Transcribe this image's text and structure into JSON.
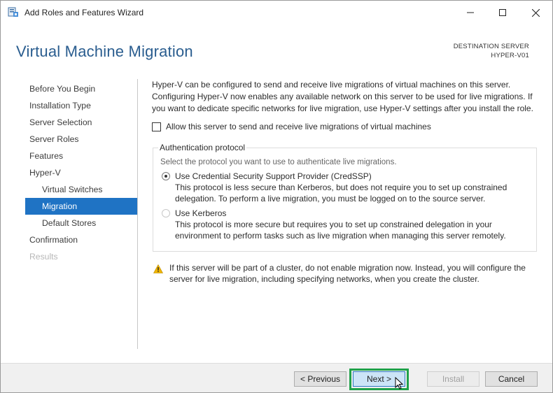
{
  "window": {
    "title": "Add Roles and Features Wizard",
    "controls": {
      "minimize": "minimize-icon",
      "maximize": "maximize-icon",
      "close": "close-icon"
    }
  },
  "header": {
    "page_title": "Virtual Machine Migration",
    "destination_label": "DESTINATION SERVER",
    "destination_server": "HYPER-V01"
  },
  "nav": {
    "items": [
      {
        "label": "Before You Begin",
        "state": "normal"
      },
      {
        "label": "Installation Type",
        "state": "normal"
      },
      {
        "label": "Server Selection",
        "state": "normal"
      },
      {
        "label": "Server Roles",
        "state": "normal"
      },
      {
        "label": "Features",
        "state": "normal"
      },
      {
        "label": "Hyper-V",
        "state": "normal"
      },
      {
        "label": "Virtual Switches",
        "state": "sub"
      },
      {
        "label": "Migration",
        "state": "active"
      },
      {
        "label": "Default Stores",
        "state": "sub"
      },
      {
        "label": "Confirmation",
        "state": "normal"
      },
      {
        "label": "Results",
        "state": "disabled"
      }
    ]
  },
  "content": {
    "intro": "Hyper-V can be configured to send and receive live migrations of virtual machines on this server. Configuring Hyper-V now enables any available network on this server to be used for live migrations. If you want to dedicate specific networks for live migration, use Hyper-V settings after you install the role.",
    "allow_checkbox": {
      "label": "Allow this server to send and receive live migrations of virtual machines",
      "checked": false
    },
    "auth": {
      "legend": "Authentication protocol",
      "description": "Select the protocol you want to use to authenticate live migrations.",
      "options": [
        {
          "title": "Use Credential Security Support Provider (CredSSP)",
          "detail": "This protocol is less secure than Kerberos, but does not require you to set up constrained delegation. To perform a live migration, you must be logged on to the source server.",
          "selected": true
        },
        {
          "title": "Use Kerberos",
          "detail": "This protocol is more secure but requires you to set up constrained delegation in your environment to perform tasks such as live migration when managing this server remotely.",
          "selected": false
        }
      ]
    },
    "warning": "If this server will be part of a cluster, do not enable migration now. Instead, you will configure the server for live migration, including specifying networks, when you create the cluster."
  },
  "footer": {
    "previous": "< Previous",
    "next": "Next >",
    "install": "Install",
    "cancel": "Cancel"
  },
  "colors": {
    "title_blue": "#2a5d8f",
    "nav_active_bg": "#1f73c4",
    "highlight_green": "#1fa24a",
    "warning_yellow": "#f0b400"
  }
}
